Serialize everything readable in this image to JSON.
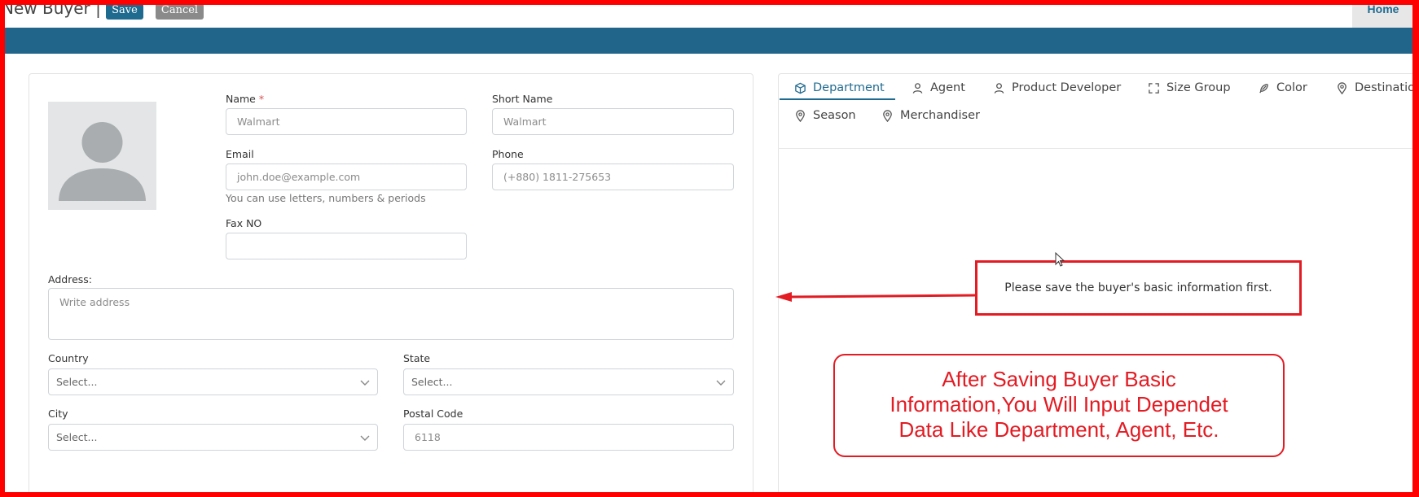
{
  "header": {
    "title": "New Buyer |",
    "save_label": "Save",
    "cancel_label": "Cancel",
    "home_label": "Home"
  },
  "form": {
    "name_label": "Name",
    "name_required": "*",
    "name_value": "Walmart",
    "short_name_label": "Short Name",
    "short_name_value": "Walmart",
    "email_label": "Email",
    "email_placeholder": "john.doe@example.com",
    "email_hint": "You can use letters, numbers & periods",
    "phone_label": "Phone",
    "phone_placeholder": "(+880) 1811-275653",
    "fax_label": "Fax NO",
    "fax_value": "",
    "address_label": "Address:",
    "address_placeholder": "Write address",
    "country_label": "Country",
    "country_value": "Select...",
    "state_label": "State",
    "state_value": "Select...",
    "city_label": "City",
    "city_value": "Select...",
    "postal_label": "Postal Code",
    "postal_value": "6118"
  },
  "tabs": [
    {
      "label": "Department",
      "icon": "cube-icon",
      "active": true
    },
    {
      "label": "Agent",
      "icon": "user-icon",
      "active": false
    },
    {
      "label": "Product Developer",
      "icon": "user-icon",
      "active": false
    },
    {
      "label": "Size Group",
      "icon": "expand-icon",
      "active": false
    },
    {
      "label": "Color",
      "icon": "feather-icon",
      "active": false
    },
    {
      "label": "Destination",
      "icon": "map-pin-icon",
      "active": false
    },
    {
      "label": "Season",
      "icon": "map-pin-icon",
      "active": false
    },
    {
      "label": "Merchandiser",
      "icon": "map-pin-icon",
      "active": false
    }
  ],
  "panel": {
    "message": "Please save the buyer's basic information first."
  },
  "annotation": {
    "callout_line1": "After Saving Buyer Basic",
    "callout_line2": "Information,You Will Input Dependet",
    "callout_line3": "Data Like Department, Agent, Etc.",
    "color": "#e31b23"
  },
  "colors": {
    "primary": "#1f6a8f",
    "header_bar": "#22658a",
    "cancel": "#8a8a8a"
  }
}
